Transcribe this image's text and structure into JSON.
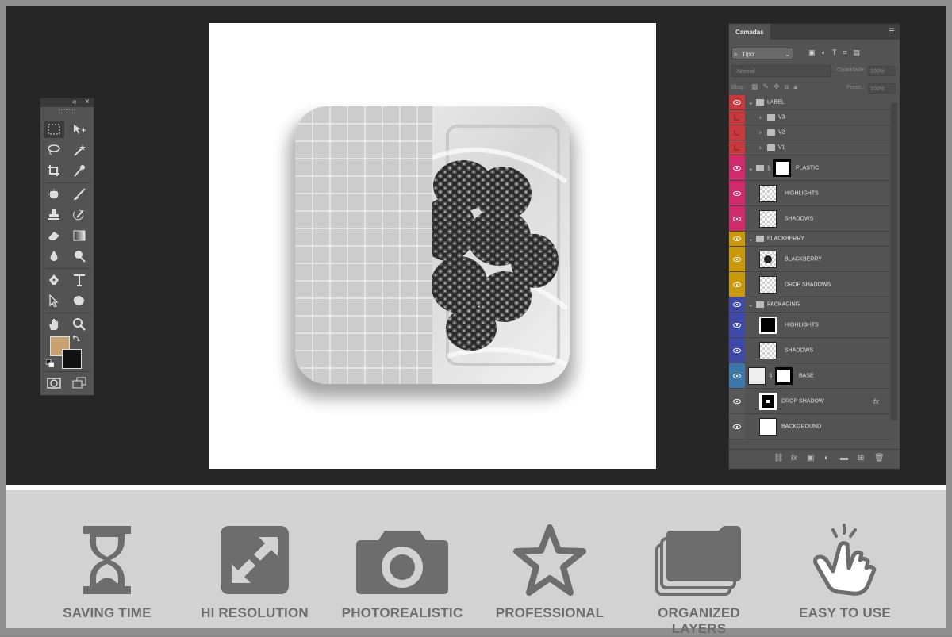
{
  "layers_panel": {
    "tab_label": "Camadas",
    "filter_value": "Tipo",
    "blend_mode": "Normal",
    "opacity_label": "Opacidade:",
    "opacity_value": "100%",
    "lock_label": "Bloq.:",
    "fill_label": "Preen.:",
    "fill_value": "100%",
    "layers": [
      {
        "name": "LABEL",
        "kind": "group",
        "color": "#c8393d",
        "visible": true
      },
      {
        "name": "V3",
        "kind": "group",
        "color": "#c8393d",
        "visible": false
      },
      {
        "name": "V2",
        "kind": "group",
        "color": "#c8393d",
        "visible": false
      },
      {
        "name": "V1",
        "kind": "group",
        "color": "#c8393d",
        "visible": false
      },
      {
        "name": "PLASTIC",
        "kind": "group-mask",
        "color": "#cf2a6a",
        "visible": true
      },
      {
        "name": "HIGHLIGHTS",
        "kind": "layer",
        "color": "#cf2a6a",
        "visible": true
      },
      {
        "name": "SHADOWS",
        "kind": "layer",
        "color": "#cf2a6a",
        "visible": true
      },
      {
        "name": "BLACKBERRY",
        "kind": "group",
        "color": "#c9990c",
        "visible": true
      },
      {
        "name": "BLACKBERRY",
        "kind": "layer",
        "color": "#c9990c",
        "visible": true
      },
      {
        "name": "DROP SHADOWS",
        "kind": "layer",
        "color": "#c9990c",
        "visible": true
      },
      {
        "name": "PACKAGING",
        "kind": "group",
        "color": "#3f49a8",
        "visible": true
      },
      {
        "name": "HIGHLIGHTS",
        "kind": "layer",
        "color": "#3f49a8",
        "visible": true
      },
      {
        "name": "SHADOWS",
        "kind": "layer",
        "color": "#3f49a8",
        "visible": true
      },
      {
        "name": "BASE",
        "kind": "layer-mask",
        "color": "#3d77aa",
        "visible": true
      },
      {
        "name": "DROP SHADOW",
        "kind": "layer-fx",
        "color": "#595959",
        "visible": true
      },
      {
        "name": "BACKGROUND",
        "kind": "layer",
        "color": "#595959",
        "visible": true
      }
    ],
    "fx_label": "fx"
  },
  "features": [
    {
      "label": "SAVING TIME",
      "icon": "hourglass-icon"
    },
    {
      "label": "HI RESOLUTION",
      "icon": "expand-icon"
    },
    {
      "label": "PHOTOREALISTIC",
      "icon": "camera-icon"
    },
    {
      "label": "PROFESSIONAL",
      "icon": "star-icon"
    },
    {
      "label": "ORGANIZED LAYERS",
      "icon": "layers-folder-icon"
    },
    {
      "label": "EASY TO USE",
      "icon": "tap-hand-icon"
    }
  ],
  "colors": {
    "foreground_swatch": "#c8a270",
    "background_swatch": "#111111",
    "workspace": "#262626",
    "feature_bar": "#d2d2d2",
    "feature_text": "#6d6d6d"
  }
}
